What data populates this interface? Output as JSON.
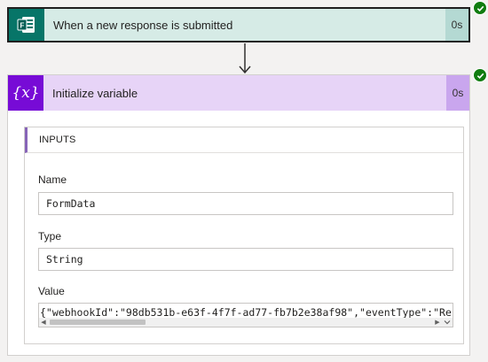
{
  "trigger": {
    "title": "When a new response is submitted",
    "duration": "0s",
    "icon": "forms-icon",
    "color": "#077568",
    "status": "succeeded"
  },
  "action": {
    "title": "Initialize variable",
    "duration": "0s",
    "icon": "variable-icon",
    "icon_text": "{x}",
    "color": "#770bd6",
    "status": "succeeded",
    "inputs": {
      "header": "INPUTS",
      "name_label": "Name",
      "name_value": "FormData",
      "type_label": "Type",
      "type_value": "String",
      "value_label": "Value",
      "value_value": "{\"webhookId\":\"98db531b-e63f-4f7f-ad77-fb7b2e38af98\",\"eventType\":\"Re"
    }
  }
}
